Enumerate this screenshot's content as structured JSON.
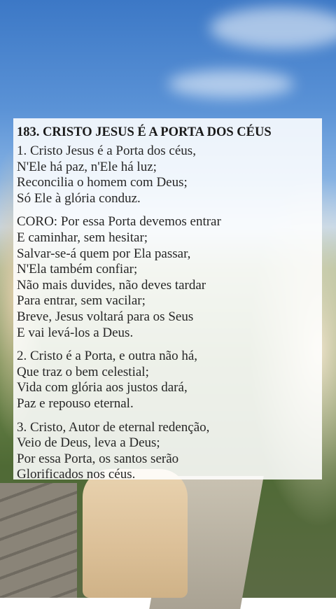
{
  "hymn": {
    "title": "183. CRISTO JESUS É A PORTA DOS CÉUS",
    "stanzas": [
      {
        "lines": [
          "1. Cristo Jesus é a Porta dos céus,",
          "N'Ele há paz, n'Ele há luz;",
          "Reconcilia o homem com Deus;",
          "Só Ele à glória conduz."
        ]
      },
      {
        "lines": [
          "CORO: Por essa Porta devemos entrar",
          "E caminhar, sem hesitar;",
          "Salvar-se-á quem por Ela passar,",
          "N'Ela também confiar;",
          "Não mais duvides, não deves tardar",
          "Para entrar, sem vacilar;",
          "Breve, Jesus voltará para os Seus",
          "E vai levá-los a Deus."
        ]
      },
      {
        "lines": [
          "2. Cristo é a Porta, e outra não há,",
          "Que traz o bem celestial;",
          "Vida com glória aos justos dará,",
          "Paz e repouso eternal."
        ]
      },
      {
        "lines": [
          "3. Cristo, Autor de eternal redenção,",
          "Veio de Deus, leva a Deus;",
          "Por essa Porta, os santos serão",
          "Glorificados nos céus."
        ]
      }
    ]
  }
}
